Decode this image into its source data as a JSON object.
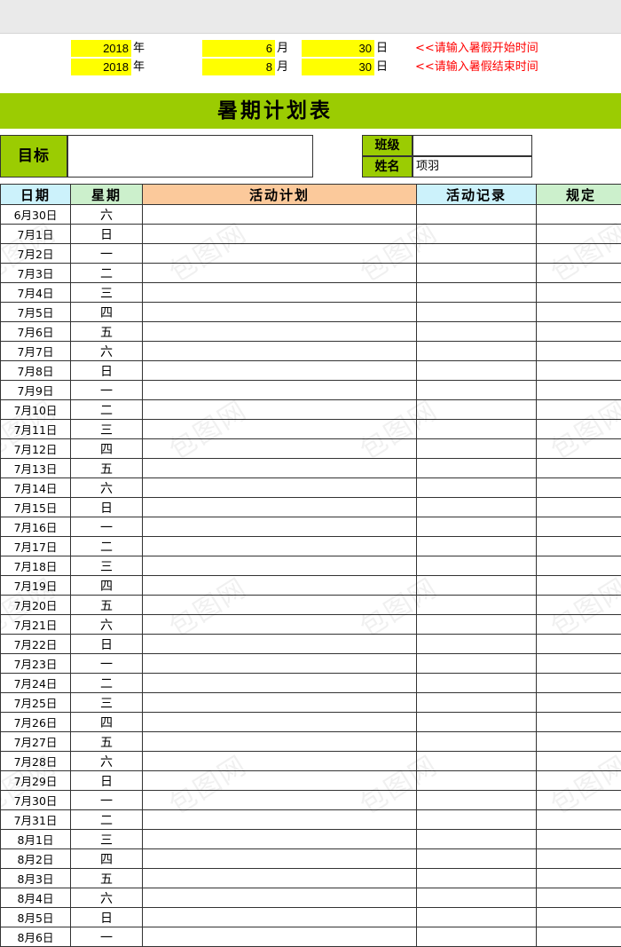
{
  "header": {
    "start": {
      "year": "2018",
      "year_unit": "年",
      "month": "6",
      "month_unit": "月",
      "day": "30",
      "day_unit": "日",
      "hint": "<<请输入暑假开始时间"
    },
    "end": {
      "year": "2018",
      "year_unit": "年",
      "month": "8",
      "month_unit": "月",
      "day": "30",
      "day_unit": "日",
      "hint": "<<请输入暑假结束时间"
    }
  },
  "title": "暑期计划表",
  "meta": {
    "goal_label": "目标",
    "goal_value": "",
    "class_label": "班级",
    "class_value": "",
    "name_label": "姓名",
    "name_value": "项羽"
  },
  "table": {
    "columns": [
      "日期",
      "星期",
      "活动计划",
      "活动记录",
      "规定"
    ],
    "rows": [
      {
        "date": "6月30日",
        "week": "六",
        "plan": "",
        "record": "",
        "rule": ""
      },
      {
        "date": "7月1日",
        "week": "日",
        "plan": "",
        "record": "",
        "rule": ""
      },
      {
        "date": "7月2日",
        "week": "一",
        "plan": "",
        "record": "",
        "rule": ""
      },
      {
        "date": "7月3日",
        "week": "二",
        "plan": "",
        "record": "",
        "rule": ""
      },
      {
        "date": "7月4日",
        "week": "三",
        "plan": "",
        "record": "",
        "rule": ""
      },
      {
        "date": "7月5日",
        "week": "四",
        "plan": "",
        "record": "",
        "rule": ""
      },
      {
        "date": "7月6日",
        "week": "五",
        "plan": "",
        "record": "",
        "rule": ""
      },
      {
        "date": "7月7日",
        "week": "六",
        "plan": "",
        "record": "",
        "rule": ""
      },
      {
        "date": "7月8日",
        "week": "日",
        "plan": "",
        "record": "",
        "rule": ""
      },
      {
        "date": "7月9日",
        "week": "一",
        "plan": "",
        "record": "",
        "rule": ""
      },
      {
        "date": "7月10日",
        "week": "二",
        "plan": "",
        "record": "",
        "rule": ""
      },
      {
        "date": "7月11日",
        "week": "三",
        "plan": "",
        "record": "",
        "rule": ""
      },
      {
        "date": "7月12日",
        "week": "四",
        "plan": "",
        "record": "",
        "rule": ""
      },
      {
        "date": "7月13日",
        "week": "五",
        "plan": "",
        "record": "",
        "rule": ""
      },
      {
        "date": "7月14日",
        "week": "六",
        "plan": "",
        "record": "",
        "rule": ""
      },
      {
        "date": "7月15日",
        "week": "日",
        "plan": "",
        "record": "",
        "rule": ""
      },
      {
        "date": "7月16日",
        "week": "一",
        "plan": "",
        "record": "",
        "rule": ""
      },
      {
        "date": "7月17日",
        "week": "二",
        "plan": "",
        "record": "",
        "rule": ""
      },
      {
        "date": "7月18日",
        "week": "三",
        "plan": "",
        "record": "",
        "rule": ""
      },
      {
        "date": "7月19日",
        "week": "四",
        "plan": "",
        "record": "",
        "rule": ""
      },
      {
        "date": "7月20日",
        "week": "五",
        "plan": "",
        "record": "",
        "rule": ""
      },
      {
        "date": "7月21日",
        "week": "六",
        "plan": "",
        "record": "",
        "rule": ""
      },
      {
        "date": "7月22日",
        "week": "日",
        "plan": "",
        "record": "",
        "rule": ""
      },
      {
        "date": "7月23日",
        "week": "一",
        "plan": "",
        "record": "",
        "rule": ""
      },
      {
        "date": "7月24日",
        "week": "二",
        "plan": "",
        "record": "",
        "rule": ""
      },
      {
        "date": "7月25日",
        "week": "三",
        "plan": "",
        "record": "",
        "rule": ""
      },
      {
        "date": "7月26日",
        "week": "四",
        "plan": "",
        "record": "",
        "rule": ""
      },
      {
        "date": "7月27日",
        "week": "五",
        "plan": "",
        "record": "",
        "rule": ""
      },
      {
        "date": "7月28日",
        "week": "六",
        "plan": "",
        "record": "",
        "rule": ""
      },
      {
        "date": "7月29日",
        "week": "日",
        "plan": "",
        "record": "",
        "rule": ""
      },
      {
        "date": "7月30日",
        "week": "一",
        "plan": "",
        "record": "",
        "rule": ""
      },
      {
        "date": "7月31日",
        "week": "二",
        "plan": "",
        "record": "",
        "rule": ""
      },
      {
        "date": "8月1日",
        "week": "三",
        "plan": "",
        "record": "",
        "rule": ""
      },
      {
        "date": "8月2日",
        "week": "四",
        "plan": "",
        "record": "",
        "rule": ""
      },
      {
        "date": "8月3日",
        "week": "五",
        "plan": "",
        "record": "",
        "rule": ""
      },
      {
        "date": "8月4日",
        "week": "六",
        "plan": "",
        "record": "",
        "rule": ""
      },
      {
        "date": "8月5日",
        "week": "日",
        "plan": "",
        "record": "",
        "rule": ""
      },
      {
        "date": "8月6日",
        "week": "一",
        "plan": "",
        "record": "",
        "rule": ""
      }
    ]
  },
  "colors": {
    "banner_green": "#9bcc02",
    "header_blue": "#ccf2fb",
    "header_green": "#ccf0cc",
    "header_orange": "#fbc99b",
    "input_yellow": "#ffff00",
    "hint_red": "#ff0000",
    "top_strip": "#eaeaea"
  },
  "watermark": {
    "text": "包图网"
  }
}
